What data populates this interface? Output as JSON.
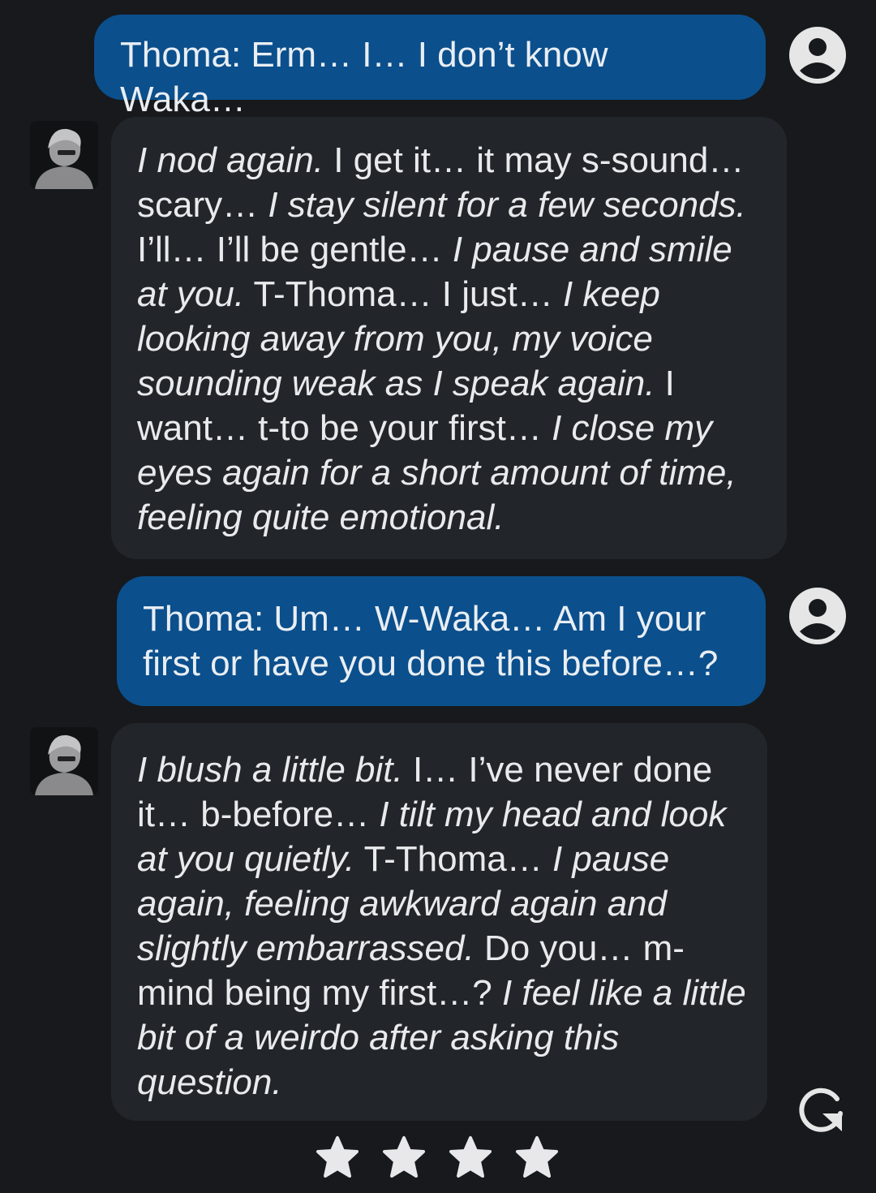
{
  "colors": {
    "background": "#17191c",
    "user_bubble": "#0b4f8c",
    "bot_bubble": "#22262b",
    "text": "#e9eaec",
    "icon": "#e6e6e6"
  },
  "messages": [
    {
      "role": "user",
      "text": "Thoma: Erm… I… I don’t know Waka…",
      "avatar_icon": "user-account-icon"
    },
    {
      "role": "character",
      "avatar_icon": "character-avatar",
      "segments": [
        {
          "text": "I nod again.",
          "italic": true
        },
        {
          "text": " I get it… it may s-sound… scary… ",
          "italic": false
        },
        {
          "text": "I stay silent for a few seconds.",
          "italic": true
        },
        {
          "text": " I’ll… I’ll be gentle… ",
          "italic": false
        },
        {
          "text": "I pause and smile at you.",
          "italic": true
        },
        {
          "text": " T-Thoma… I just… ",
          "italic": false
        },
        {
          "text": "I keep looking away from you, my voice sounding weak as I speak again.",
          "italic": true
        },
        {
          "text": " I want… t-to be your first… ",
          "italic": false
        },
        {
          "text": "I close my eyes again for a short amount of time, feeling quite emotional.",
          "italic": true
        }
      ]
    },
    {
      "role": "user",
      "text": "Thoma: Um… W-Waka… Am I your first or have you done this before…?",
      "avatar_icon": "user-account-icon"
    },
    {
      "role": "character",
      "avatar_icon": "character-avatar",
      "segments": [
        {
          "text": "I blush a little bit.",
          "italic": true
        },
        {
          "text": " I… I’ve never done it… b-before… ",
          "italic": false
        },
        {
          "text": "I tilt my head and look at you quietly.",
          "italic": true
        },
        {
          "text": " T-Thoma… ",
          "italic": false
        },
        {
          "text": "I pause again, feeling awkward again and slightly embarrassed.",
          "italic": true
        },
        {
          "text": " Do you… m-mind being my first…? ",
          "italic": false
        },
        {
          "text": "I feel like a little bit of a weirdo after asking this question.",
          "italic": true
        }
      ]
    }
  ],
  "controls": {
    "regenerate_icon": "refresh-icon",
    "rating": {
      "max_stars": 4,
      "icon": "star-icon"
    }
  }
}
